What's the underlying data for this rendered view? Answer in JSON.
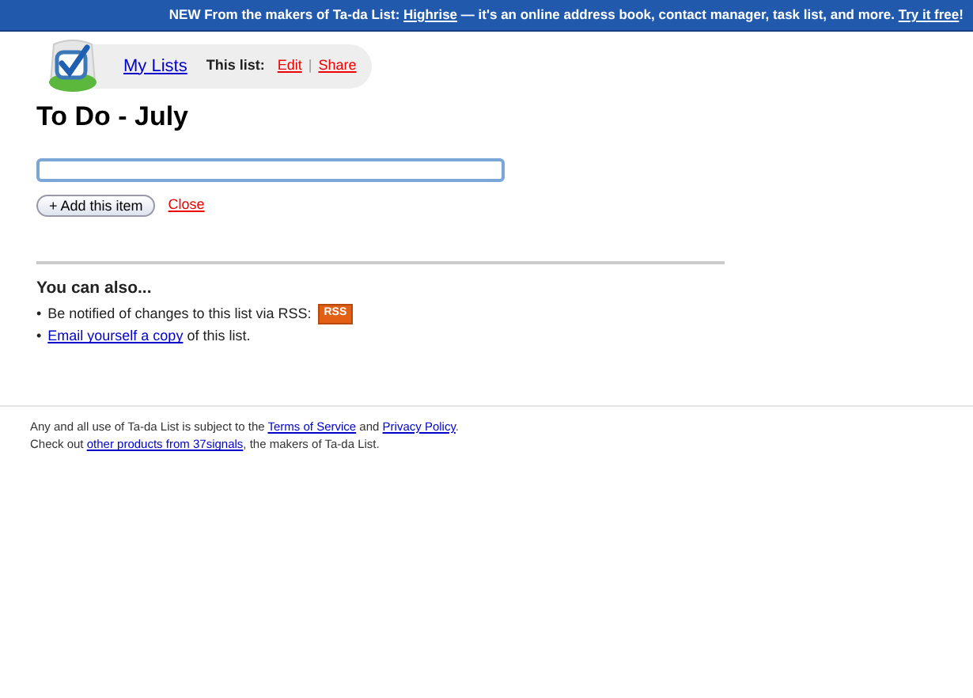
{
  "banner": {
    "parts": [
      {
        "text": "NEW From the makers of Ta-da List: "
      },
      {
        "link": "Highrise"
      },
      {
        "text": " — it's an online address book, contact manager, task list, and more. "
      },
      {
        "link": "Try it free"
      },
      {
        "text": "!"
      }
    ]
  },
  "nav": {
    "my_lists": "My Lists",
    "this_list_label": "This list:",
    "links": [
      "Edit",
      "Share"
    ],
    "separator": "|"
  },
  "title": "To Do - July",
  "new_item": {
    "button": "Add this item",
    "button_icon": "+",
    "close": "Close"
  },
  "also": {
    "heading": "You can also...",
    "items": [
      {
        "bullet": "•",
        "parts": [
          {
            "text": "Be notified of changes to this list via RSS: "
          }
        ],
        "badge": "RSS"
      },
      {
        "bullet": "•",
        "parts": [
          {
            "link": "Email yourself a copy"
          },
          {
            "text": " of this list."
          }
        ]
      }
    ]
  },
  "footer": [
    {
      "parts": [
        {
          "text": "Any and all use of Ta-da List is subject to the "
        },
        {
          "link": "Terms of Service"
        },
        {
          "text": " and "
        },
        {
          "link": "Privacy Policy"
        },
        {
          "text": "."
        }
      ]
    },
    {
      "parts": [
        {
          "text": "Check out "
        },
        {
          "link": "other products from 37signals"
        },
        {
          "text": ", the makers of Ta-da List."
        }
      ]
    }
  ]
}
